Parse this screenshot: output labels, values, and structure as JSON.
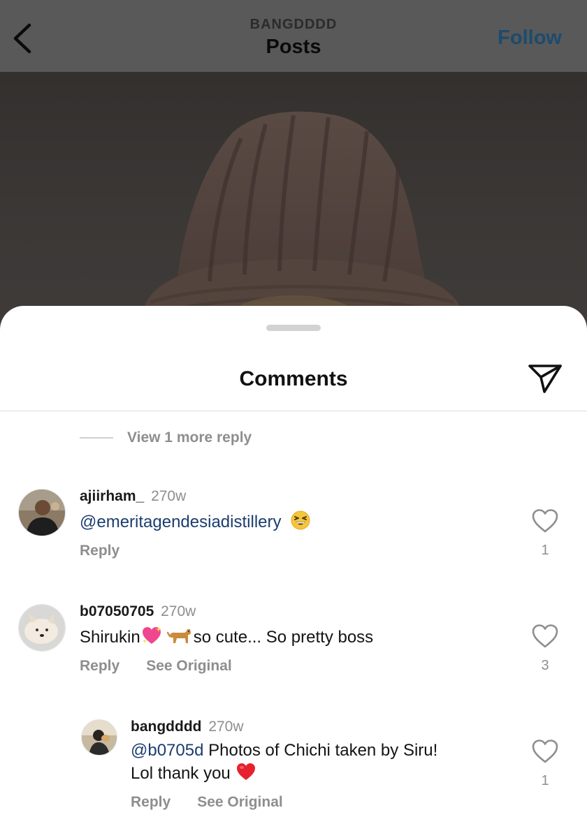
{
  "header": {
    "account": "BANGDDDD",
    "title": "Posts",
    "follow_label": "Follow"
  },
  "sheet": {
    "title": "Comments",
    "view_more_replies": "View 1 more reply"
  },
  "comments": [
    {
      "username": "ajiirham_",
      "time": "270w",
      "mention": "@emeritagendesiadistillery",
      "text": "",
      "emojis": [
        "grinning-squinting-face"
      ],
      "reply_label": "Reply",
      "likes": "1"
    },
    {
      "username": "b07050705",
      "time": "270w",
      "text_before": "Shirukin",
      "text_after": "so cute... So pretty boss",
      "emojis": [
        "sparkling-heart",
        "dog"
      ],
      "reply_label": "Reply",
      "see_original_label": "See Original",
      "likes": "3"
    },
    {
      "username": "bangdddd",
      "time": "270w",
      "mention": "@b0705d",
      "text_line1": " Photos of Chichi taken by Siru!",
      "text_line2": "Lol thank you ",
      "emojis": [
        "red-heart"
      ],
      "reply_label": "Reply",
      "see_original_label": "See Original",
      "likes": "1",
      "is_reply": true
    }
  ],
  "icons": {
    "back": "chevron-left-icon",
    "share": "paper-plane-icon",
    "like": "heart-outline-icon"
  },
  "colors": {
    "follow": "#1d4b6e",
    "mention": "#1c3d6e",
    "secondary_text": "#8e8e8e"
  }
}
